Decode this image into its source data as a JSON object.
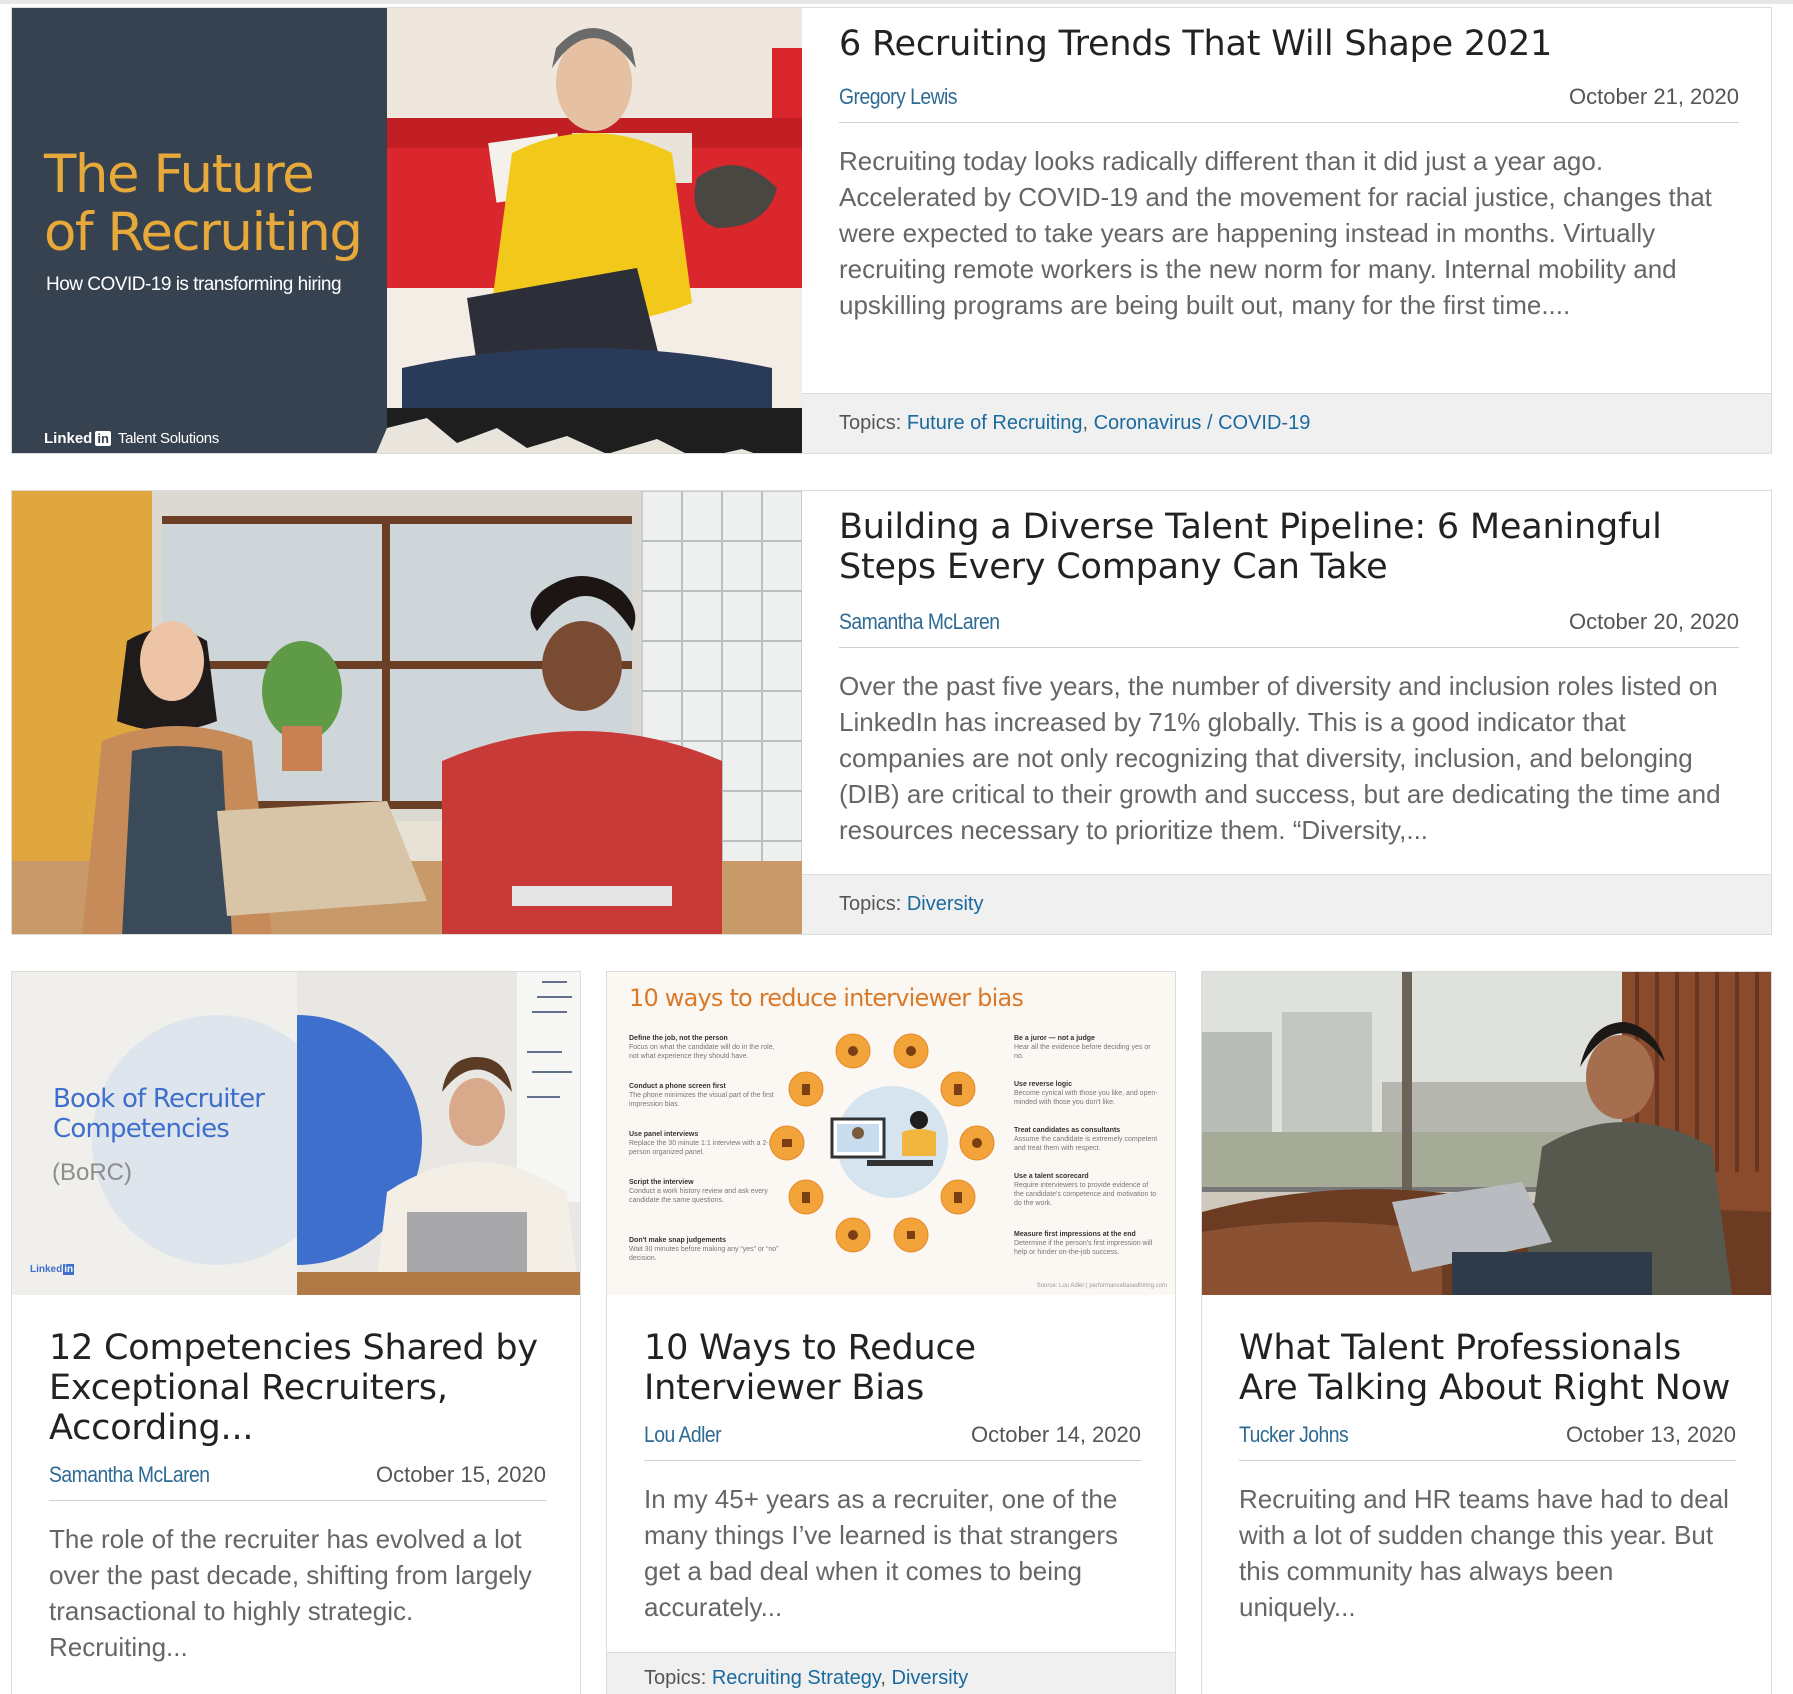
{
  "articles": [
    {
      "title": "6 Recruiting Trends That Will Shape 2021",
      "author": "Gregory Lewis",
      "date": "October 21, 2020",
      "excerpt": "Recruiting today looks radically different than it did just a year ago. Accelerated by COVID-19 and the movement for racial justice, changes that were expected to take years are happening instead in months. Virtually recruiting remote workers is the new norm for many. Internal mobility and upskilling programs are being built out, many for the first time....",
      "topics_label": "Topics:",
      "topics": [
        "Future of Recruiting",
        "Coronavirus / COVID-19"
      ],
      "image": {
        "headline": "The Future of Recruiting",
        "subhead": "How COVID-19 is transforming hiring",
        "brand": "Linked",
        "brand_in": "in",
        "brand_suffix": "Talent Solutions"
      }
    },
    {
      "title": "Building a Diverse Talent Pipeline: 6 Meaningful Steps Every Company Can Take",
      "author": "Samantha McLaren",
      "date": "October 20, 2020",
      "excerpt": "Over the past five years, the number of diversity and inclusion roles listed on LinkedIn has increased by 71% globally. This is a good indicator that companies are not only recognizing that diversity, inclusion, and belonging (DIB) are critical to their growth and success, but are dedicating the time and resources necessary to prioritize them. “Diversity,...",
      "topics_label": "Topics:",
      "topics": [
        "Diversity"
      ]
    },
    {
      "title": "12 Competencies Shared by Exceptional Recruiters, According...",
      "author": "Samantha McLaren",
      "date": "October 15, 2020",
      "excerpt": "The role of the recruiter has evolved a lot over the past decade, shifting from largely transactional to highly strategic. Recruiting...",
      "image": {
        "headline_line1": "Book of Recruiter",
        "headline_line2": "Competencies",
        "abbrev": "(BoRC)",
        "brand": "Linked",
        "brand_in": "in"
      }
    },
    {
      "title": "10 Ways to Reduce Interviewer Bias",
      "author": "Lou Adler",
      "date": "October 14, 2020",
      "excerpt": "In my 45+ years as a recruiter, one of the many things I’ve learned is that strangers get a bad deal when it comes to being accurately...",
      "topics_label": "Topics:",
      "topics": [
        "Recruiting Strategy",
        "Diversity"
      ],
      "image": {
        "headline": "10 ways to reduce interviewer bias",
        "left_items": [
          {
            "title": "Define the job, not the person",
            "text": "Focus on what the candidate will do in the role, not what experience they should have."
          },
          {
            "title": "Conduct a phone screen first",
            "text": "The phone minimizes the visual part of the first impression bias."
          },
          {
            "title": "Use panel interviews",
            "text": "Replace the 30 minute 1:1 interview with a 2-3 person organized panel."
          },
          {
            "title": "Script the interview",
            "text": "Conduct a work history review and ask every candidate the same questions."
          },
          {
            "title": "Don't make snap judgements",
            "text": "Wait 30 minutes before making any “yes” or “no” decision."
          }
        ],
        "right_items": [
          {
            "title": "Be a juror — not a judge",
            "text": "Hear all the evidence before deciding yes or no."
          },
          {
            "title": "Use reverse logic",
            "text": "Become cynical with those you like, and open-minded with those you don't like."
          },
          {
            "title": "Treat candidates as consultants",
            "text": "Assume the candidate is extremely competent and treat them with respect."
          },
          {
            "title": "Use a talent scorecard",
            "text": "Require interviewers to provide evidence of the candidate's competence and motivation to do the work."
          },
          {
            "title": "Measure first impressions at the end",
            "text": "Determine if the person's first impression will help or hinder on-the-job success."
          }
        ],
        "source": "Source: Lou Adler | performancebasedhiring.com"
      }
    },
    {
      "title": "What Talent Professionals Are Talking About Right Now",
      "author": "Tucker Johns",
      "date": "October 13, 2020",
      "excerpt": "Recruiting and HR teams have had to deal with a lot of sudden change this year. But this community has always been uniquely..."
    }
  ],
  "colors": {
    "link": "#1a6a9e",
    "author": "#2e6a93",
    "slate": "#374250",
    "gold": "#e8a93b",
    "blue": "#3f6fcc"
  }
}
